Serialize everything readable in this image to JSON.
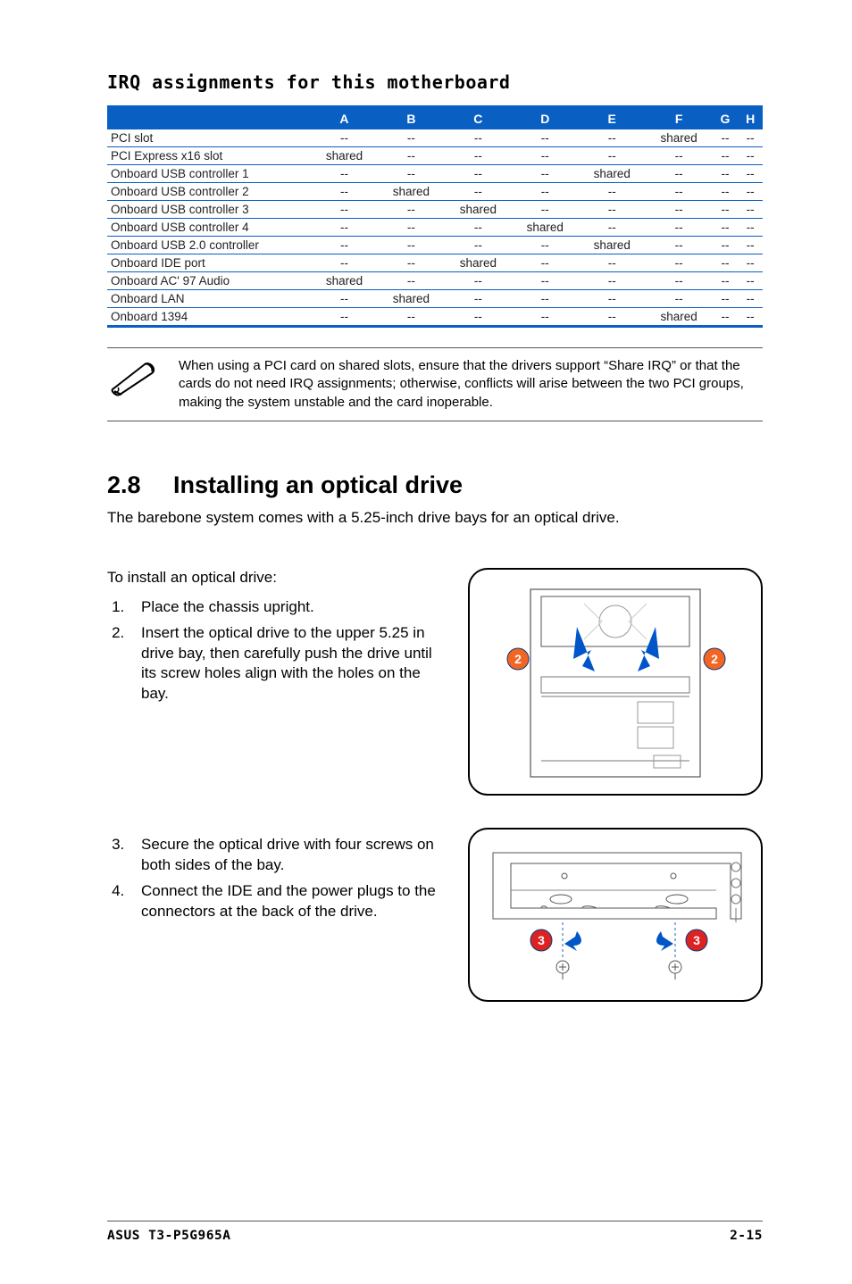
{
  "subheading": "IRQ assignments for this motherboard",
  "table": {
    "headers": [
      "",
      "A",
      "B",
      "C",
      "D",
      "E",
      "F",
      "G",
      "H"
    ],
    "rows": [
      [
        "PCI slot",
        "--",
        "--",
        "--",
        "--",
        "--",
        "shared",
        "--",
        "--"
      ],
      [
        "PCI Express x16 slot",
        "shared",
        "--",
        "--",
        "--",
        "--",
        "--",
        "--",
        "--"
      ],
      [
        "Onboard USB controller 1",
        "--",
        "--",
        "--",
        "--",
        "shared",
        "--",
        "--",
        "--"
      ],
      [
        "Onboard USB controller 2",
        "--",
        "shared",
        "--",
        "--",
        "--",
        "--",
        "--",
        "--"
      ],
      [
        "Onboard USB controller 3",
        "--",
        "--",
        "shared",
        "--",
        "--",
        "--",
        "--",
        "--"
      ],
      [
        "Onboard USB controller 4",
        "--",
        "--",
        "--",
        "shared",
        "--",
        "--",
        "--",
        "--"
      ],
      [
        "Onboard USB 2.0 controller",
        "--",
        "--",
        "--",
        "--",
        "shared",
        "--",
        "--",
        "--"
      ],
      [
        "Onboard IDE port",
        "--",
        "--",
        "shared",
        "--",
        "--",
        "--",
        "--",
        "--"
      ],
      [
        "Onboard AC' 97 Audio",
        "shared",
        "--",
        "--",
        "--",
        "--",
        "--",
        "--",
        "--"
      ],
      [
        "Onboard LAN",
        "--",
        "shared",
        "--",
        "--",
        "--",
        "--",
        "--",
        "--"
      ],
      [
        "Onboard 1394",
        "--",
        "--",
        "--",
        "--",
        "--",
        "shared",
        "--",
        "--"
      ]
    ]
  },
  "note": "When using a PCI card on shared slots, ensure that the drivers support “Share IRQ” or that the cards do not need IRQ assignments; otherwise, conflicts will arise between the two PCI groups, making the system unstable and the card inoperable.",
  "section_number": "2.8",
  "section_title": "Installing an optical drive",
  "section_intro": "The barebone system comes with a 5.25-inch drive bays for an optical drive.",
  "steps_intro": "To install an optical drive:",
  "steps12": [
    "Place the chassis upright.",
    "Insert the optical drive to the upper 5.25 in drive bay, then carefully push the drive until its screw holes align with the holes on the bay."
  ],
  "steps34": [
    "Secure the optical drive with four screws on both sides of the bay.",
    "Connect the IDE and the power plugs to the connectors at the back of the drive."
  ],
  "callouts": {
    "fig1_left": "2",
    "fig1_right": "2",
    "fig2_left": "3",
    "fig2_right": "3"
  },
  "footer_left": "ASUS T3-P5G965A",
  "footer_right": "2-15"
}
